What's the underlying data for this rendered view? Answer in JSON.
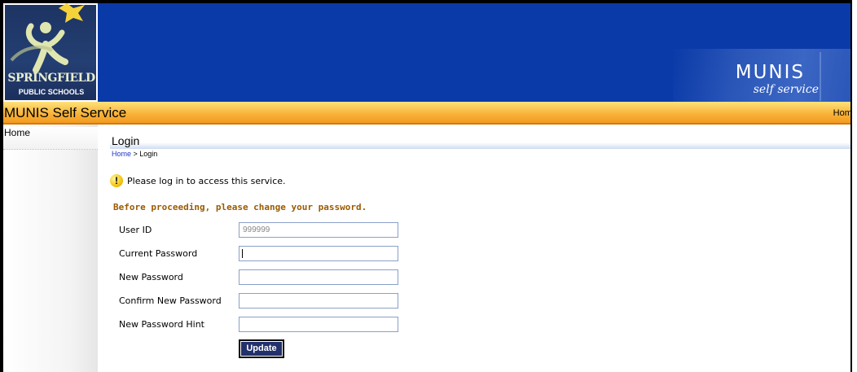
{
  "banner": {
    "logo_line1": "SPRINGFIELD",
    "logo_line2": "PUBLIC SCHOOLS",
    "brand_title": "MUNIS",
    "brand_subtitle": "self service"
  },
  "titlebar": {
    "title": "MUNIS Self Service",
    "home_link": "Home"
  },
  "leftnav": {
    "items": [
      {
        "label": "Home"
      }
    ]
  },
  "main": {
    "heading": "Login",
    "breadcrumb": {
      "home": "Home",
      "separator": " > ",
      "current": "Login"
    },
    "notice": "Please log in to access this service.",
    "instruction": "Before proceeding, please change your password.",
    "form": {
      "user_id_label": "User ID",
      "user_id_value": "999999",
      "current_password_label": "Current Password",
      "new_password_label": "New Password",
      "confirm_password_label": "Confirm New Password",
      "password_hint_label": "New Password Hint",
      "submit_label": "Update"
    }
  },
  "colors": {
    "banner_blue": "#0a3aa8",
    "titlebar_orange": "#f8b43c",
    "instruction_brown": "#9a5b00",
    "button_navy": "#22306b"
  },
  "icons": [
    "springfield-logo-icon",
    "warning-icon"
  ]
}
